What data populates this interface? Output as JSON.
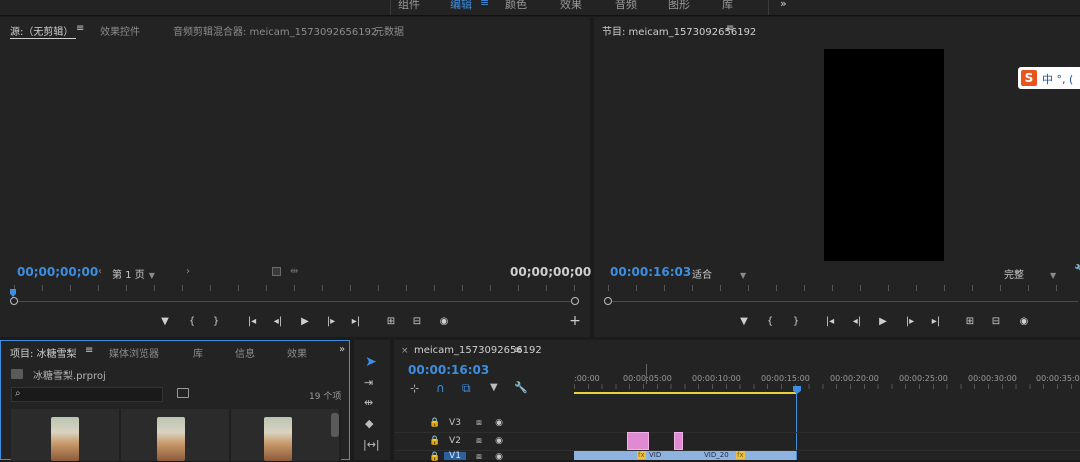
{
  "workspace": {
    "tabs": [
      "组件",
      "编辑",
      "颜色",
      "效果",
      "音频",
      "图形",
      "库"
    ],
    "active": "编辑",
    "menu_icon": "hamburger-icon",
    "more": "»"
  },
  "source_panel": {
    "tabs": [
      "源:（无剪辑）",
      "效果控件",
      "音频剪辑混合器: meicam_1573092656192",
      "元数据"
    ],
    "menu_icon": "≡",
    "timecode_left": "00;00;00;00",
    "page_label": "第 1 页",
    "timecode_right": "00;00;00;00",
    "controls": [
      "marker-icon",
      "mark-in-icon",
      "mark-out-icon",
      "go-to-in-icon",
      "step-back-icon",
      "play-icon",
      "step-forward-icon",
      "go-to-out-icon",
      "insert-icon",
      "overwrite-icon",
      "export-frame-icon",
      "add-icon"
    ],
    "add_label": "+"
  },
  "program_panel": {
    "title": "节目: meicam_1573092656192",
    "menu_icon": "≡",
    "timecode": "00:00:16:03",
    "fit_label": "适合",
    "quality_label": "完整",
    "ime_logo": "S",
    "ime_text": "中 °, ("
  },
  "project_panel": {
    "tabs": [
      "项目: 冰糖雪梨",
      "媒体浏览器",
      "库",
      "信息",
      "效果"
    ],
    "menu_icon": "≡",
    "more": "»",
    "file_name": "冰糖雪梨.prproj",
    "search_placeholder": "",
    "item_count": "19 个项"
  },
  "tools": [
    "selection-tool-icon",
    "track-select-tool-icon",
    "ripple-edit-tool-icon",
    "razor-tool-icon",
    "slip-tool-icon"
  ],
  "timeline": {
    "close": "×",
    "sequence_name": "meicam_1573092656192",
    "menu_icon": "≡",
    "timecode": "00:00:16:03",
    "ruler_labels": [
      ":00:00",
      "00:00:05:00",
      "00:00:10:00",
      "00:00:15:00",
      "00:00:20:00",
      "00:00:25:00",
      "00:00:30:00",
      "00:00:35:00"
    ],
    "tracks": [
      {
        "name": "V3"
      },
      {
        "name": "V2"
      },
      {
        "name": "V1"
      }
    ],
    "clip_labels": [
      "VID",
      "VID_20"
    ],
    "fx_label": "fx"
  }
}
